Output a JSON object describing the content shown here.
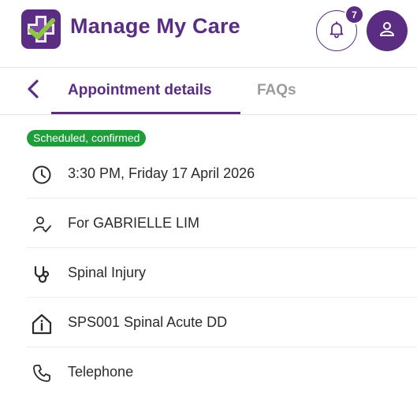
{
  "header": {
    "app_title": "Manage My Care",
    "notification_count": "7",
    "icons": {
      "logo": "care-plus-check-logo",
      "bell": "bell-icon",
      "user": "user-icon"
    }
  },
  "tabs": {
    "back_icon": "chevron-left-icon",
    "items": [
      {
        "label": "Appointment details",
        "active": true
      },
      {
        "label": "FAQs",
        "active": false
      }
    ]
  },
  "appointment": {
    "status": "Scheduled, confirmed",
    "status_color": "#1f9d3b",
    "details": [
      {
        "icon": "clock-icon",
        "text": "3:30 PM, Friday 17 April 2026"
      },
      {
        "icon": "patient-check-icon",
        "text": "For GABRIELLE LIM"
      },
      {
        "icon": "stethoscope-icon",
        "text": "Spinal Injury"
      },
      {
        "icon": "clinic-building-icon",
        "text": "SPS001 Spinal Acute DD"
      },
      {
        "icon": "phone-icon",
        "text": "Telephone"
      }
    ]
  },
  "colors": {
    "brand": "#5a2d82",
    "accent_green": "#8dc63f",
    "status_green": "#1f9d3b"
  }
}
